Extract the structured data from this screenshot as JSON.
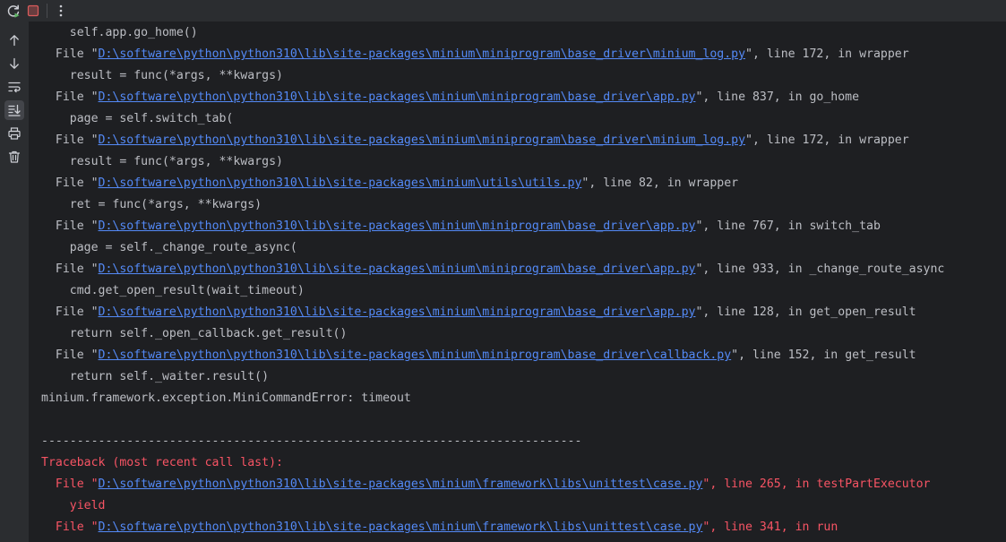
{
  "toolbar": {
    "rerun_icon": "rerun-icon",
    "stop_icon": "stop-icon",
    "more_icon": "more-vertical-icon"
  },
  "sidebar": {
    "items": [
      {
        "icon": "arrow-up-icon"
      },
      {
        "icon": "arrow-down-icon"
      },
      {
        "icon": "soft-wrap-icon"
      },
      {
        "icon": "scroll-to-end-icon"
      },
      {
        "icon": "print-icon"
      },
      {
        "icon": "trash-icon"
      }
    ]
  },
  "colors": {
    "background": "#1e1f22",
    "panel": "#2b2d30",
    "text": "#bcbec4",
    "error": "#f75464",
    "link": "#548af7",
    "stop_red": "#db5c5c",
    "rerun_green": "#5fb865"
  },
  "console": {
    "lines": [
      {
        "style": "normal",
        "parts": [
          {
            "t": "    self.app.go_home()"
          }
        ]
      },
      {
        "style": "normal",
        "parts": [
          {
            "t": "  File \""
          },
          {
            "t": "D:\\software\\python\\python310\\lib\\site-packages\\minium\\miniprogram\\base_driver\\minium_log.py",
            "link": true
          },
          {
            "t": "\", line 172, in wrapper"
          }
        ]
      },
      {
        "style": "normal",
        "parts": [
          {
            "t": "    result = func(*args, **kwargs)"
          }
        ]
      },
      {
        "style": "normal",
        "parts": [
          {
            "t": "  File \""
          },
          {
            "t": "D:\\software\\python\\python310\\lib\\site-packages\\minium\\miniprogram\\base_driver\\app.py",
            "link": true
          },
          {
            "t": "\", line 837, in go_home"
          }
        ]
      },
      {
        "style": "normal",
        "parts": [
          {
            "t": "    page = self.switch_tab("
          }
        ]
      },
      {
        "style": "normal",
        "parts": [
          {
            "t": "  File \""
          },
          {
            "t": "D:\\software\\python\\python310\\lib\\site-packages\\minium\\miniprogram\\base_driver\\minium_log.py",
            "link": true
          },
          {
            "t": "\", line 172, in wrapper"
          }
        ]
      },
      {
        "style": "normal",
        "parts": [
          {
            "t": "    result = func(*args, **kwargs)"
          }
        ]
      },
      {
        "style": "normal",
        "parts": [
          {
            "t": "  File \""
          },
          {
            "t": "D:\\software\\python\\python310\\lib\\site-packages\\minium\\utils\\utils.py",
            "link": true
          },
          {
            "t": "\", line 82, in wrapper"
          }
        ]
      },
      {
        "style": "normal",
        "parts": [
          {
            "t": "    ret = func(*args, **kwargs)"
          }
        ]
      },
      {
        "style": "normal",
        "parts": [
          {
            "t": "  File \""
          },
          {
            "t": "D:\\software\\python\\python310\\lib\\site-packages\\minium\\miniprogram\\base_driver\\app.py",
            "link": true
          },
          {
            "t": "\", line 767, in switch_tab"
          }
        ]
      },
      {
        "style": "normal",
        "parts": [
          {
            "t": "    page = self._change_route_async("
          }
        ]
      },
      {
        "style": "normal",
        "parts": [
          {
            "t": "  File \""
          },
          {
            "t": "D:\\software\\python\\python310\\lib\\site-packages\\minium\\miniprogram\\base_driver\\app.py",
            "link": true
          },
          {
            "t": "\", line 933, in _change_route_async"
          }
        ]
      },
      {
        "style": "normal",
        "parts": [
          {
            "t": "    cmd.get_open_result(wait_timeout)"
          }
        ]
      },
      {
        "style": "normal",
        "parts": [
          {
            "t": "  File \""
          },
          {
            "t": "D:\\software\\python\\python310\\lib\\site-packages\\minium\\miniprogram\\base_driver\\app.py",
            "link": true
          },
          {
            "t": "\", line 128, in get_open_result"
          }
        ]
      },
      {
        "style": "normal",
        "parts": [
          {
            "t": "    return self._open_callback.get_result()"
          }
        ]
      },
      {
        "style": "normal",
        "parts": [
          {
            "t": "  File \""
          },
          {
            "t": "D:\\software\\python\\python310\\lib\\site-packages\\minium\\miniprogram\\base_driver\\callback.py",
            "link": true
          },
          {
            "t": "\", line 152, in get_result"
          }
        ]
      },
      {
        "style": "normal",
        "parts": [
          {
            "t": "    return self._waiter.result()"
          }
        ]
      },
      {
        "style": "normal",
        "parts": [
          {
            "t": "minium.framework.exception.MiniCommandError: timeout"
          }
        ]
      },
      {
        "style": "normal",
        "parts": [
          {
            "t": ""
          }
        ]
      },
      {
        "style": "normal",
        "parts": [
          {
            "t": "----------------------------------------------------------------------------"
          }
        ]
      },
      {
        "style": "error",
        "parts": [
          {
            "t": "Traceback (most recent call last):"
          }
        ]
      },
      {
        "style": "error",
        "parts": [
          {
            "t": "  File \""
          },
          {
            "t": "D:\\software\\python\\python310\\lib\\site-packages\\minium\\framework\\libs\\unittest\\case.py",
            "link": true
          },
          {
            "t": "\", line 265, in testPartExecutor"
          }
        ]
      },
      {
        "style": "error",
        "parts": [
          {
            "t": "    yield"
          }
        ]
      },
      {
        "style": "error",
        "parts": [
          {
            "t": "  File \""
          },
          {
            "t": "D:\\software\\python\\python310\\lib\\site-packages\\minium\\framework\\libs\\unittest\\case.py",
            "link": true
          },
          {
            "t": "\", line 341, in run"
          }
        ]
      }
    ]
  }
}
